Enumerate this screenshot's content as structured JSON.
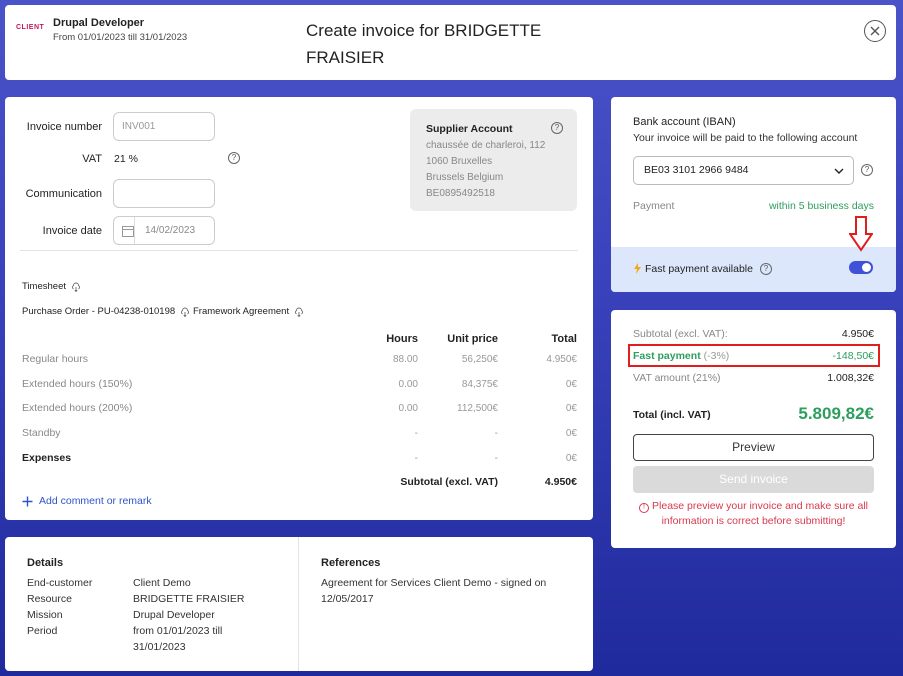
{
  "header": {
    "logo_text": "CLIENT",
    "employee_name": "Drupal Developer",
    "employee_period": "From 01/01/2023 till 31/01/2023",
    "title_line1": "Create invoice for BRIDGETTE",
    "title_line2": "FRAISIER"
  },
  "invoice_form": {
    "invoice_number_label": "Invoice number",
    "invoice_number_placeholder": "INV001",
    "vat_label": "VAT",
    "vat_value": "21 %",
    "communication_label": "Communication",
    "communication_value": "",
    "invoice_date_label": "Invoice date",
    "invoice_date_value": "14/02/2023"
  },
  "supplier": {
    "title": "Supplier Account",
    "street": "chaussée de charleroi, 112",
    "city": "1060 Bruxelles",
    "country": "Brussels Belgium",
    "vat_number": "BE0895492518"
  },
  "attachments": {
    "timesheet": "Timesheet",
    "purchase_order": "Purchase Order - PU-04238-010198",
    "framework_agreement": "Framework Agreement"
  },
  "lines_table": {
    "headers": {
      "hours": "Hours",
      "unit_price": "Unit price",
      "total": "Total"
    },
    "rows": [
      {
        "label": "Regular hours",
        "hours": "88.00",
        "unit_price": "56,250€",
        "total": "4.950€"
      },
      {
        "label": "Extended hours (150%)",
        "hours": "0.00",
        "unit_price": "84,375€",
        "total": "0€"
      },
      {
        "label": "Extended hours (200%)",
        "hours": "0.00",
        "unit_price": "112,500€",
        "total": "0€"
      },
      {
        "label": "Standby",
        "hours": "-",
        "unit_price": "-",
        "total": "0€"
      },
      {
        "label": "Expenses",
        "hours": "-",
        "unit_price": "-",
        "total": "0€"
      }
    ],
    "subtotal_label": "Subtotal (excl. VAT)",
    "subtotal_value": "4.950€",
    "add_comment": "Add comment or remark"
  },
  "details": {
    "title": "Details",
    "end_customer_key": "End-customer",
    "end_customer_value": "Client Demo",
    "resource_key": "Resource",
    "resource_value": "BRIDGETTE FRAISIER",
    "mission_key": "Mission",
    "mission_value": "Drupal Developer",
    "period_key": "Period",
    "period_value_line1": "from 01/01/2023 till",
    "period_value_line2": "31/01/2023"
  },
  "references": {
    "title": "References",
    "line1": "Agreement for Services Client Demo - signed on",
    "line2": "12/05/2017"
  },
  "bank": {
    "title": "Bank account (IBAN)",
    "subtitle": "Your invoice will be paid to the following account",
    "iban": "BE03 3101 2966 9484",
    "payment_label": "Payment",
    "payment_value": "within 5 business days",
    "fast_payment_label": "Fast payment available",
    "fast_payment_enabled": true
  },
  "totals": {
    "subtotal_label": "Subtotal (excl. VAT):",
    "subtotal_value": "4.950€",
    "fast_payment_label": "Fast payment",
    "fast_payment_pct": "(-3%)",
    "fast_payment_value": "-148,50€",
    "vat_label": "VAT amount (21%)",
    "vat_value": "1.008,32€",
    "total_label": "Total (incl. VAT)",
    "total_value": "5.809,82€",
    "preview_button": "Preview",
    "send_button": "Send invoice",
    "warning_line1": "Please preview your invoice and make sure all",
    "warning_line2": "information is correct before submitting!"
  },
  "colors": {
    "accent_blue": "#3f51d6",
    "positive_green": "#2e9e5e",
    "warning_red": "#d9394d",
    "highlight_red": "#e01e1e"
  }
}
